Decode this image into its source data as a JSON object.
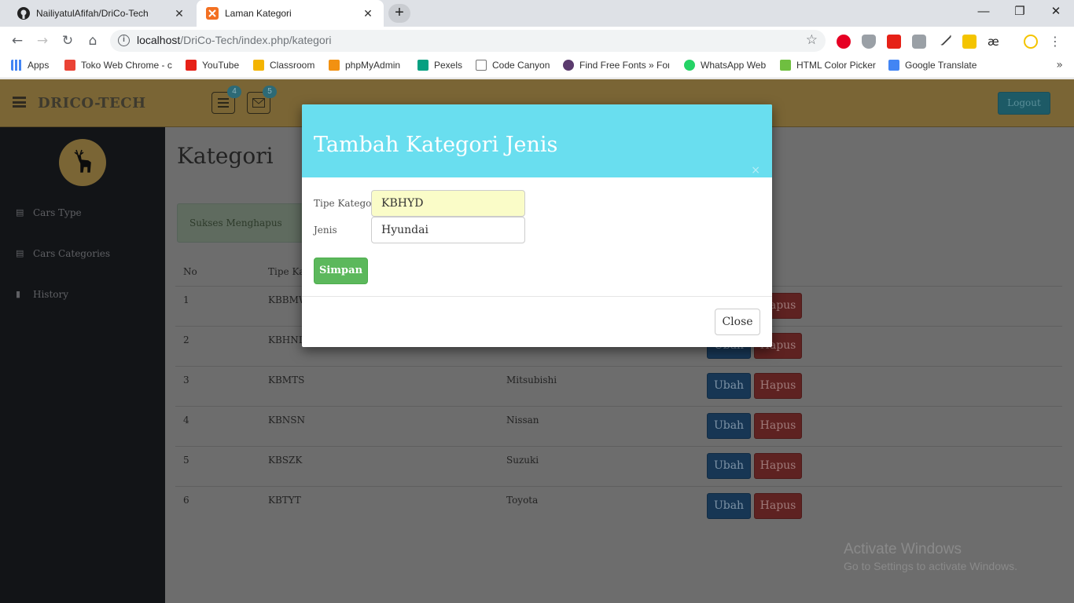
{
  "browser": {
    "tabs": [
      {
        "title": "NailiyatulAfifah/DriCo-Tech",
        "active": false
      },
      {
        "title": "Laman Kategori",
        "active": true
      }
    ],
    "url_host": "localhost",
    "url_path": "/DriCo-Tech/index.php/kategori",
    "bookmarks": [
      "Apps",
      "Toko Web Chrome - c",
      "YouTube",
      "Classroom",
      "phpMyAdmin",
      "Pexels",
      "Code Canyon",
      "Find Free Fonts » Fon",
      "WhatsApp Web",
      "HTML Color Picker",
      "Google Translate"
    ],
    "bookmarks_more": "»"
  },
  "app": {
    "brand": "DRICO-TECH",
    "badge_tasks": "4",
    "badge_messages": "5",
    "logout_label": "Logout",
    "sidebar": [
      {
        "label": "Cars Type",
        "icon": "book-icon"
      },
      {
        "label": "Cars Categories",
        "icon": "book-icon"
      },
      {
        "label": "History",
        "icon": "bookmark-icon"
      }
    ],
    "page_title": "Kategori",
    "alert_text": "Sukses Menghapus",
    "table": {
      "headers": [
        "No",
        "Tipe Ka"
      ],
      "rows": [
        {
          "no": "1",
          "tipe": "KBBMW",
          "jenis": "",
          "ubah": "",
          "hapus": "Hapus"
        },
        {
          "no": "2",
          "tipe": "KBHND",
          "jenis": "",
          "ubah": "Ubah",
          "hapus": "Hapus"
        },
        {
          "no": "3",
          "tipe": "KBMTS",
          "jenis": "Mitsubishi",
          "ubah": "Ubah",
          "hapus": "Hapus"
        },
        {
          "no": "4",
          "tipe": "KBNSN",
          "jenis": "Nissan",
          "ubah": "Ubah",
          "hapus": "Hapus"
        },
        {
          "no": "5",
          "tipe": "KBSZK",
          "jenis": "Suzuki",
          "ubah": "Ubah",
          "hapus": "Hapus"
        },
        {
          "no": "6",
          "tipe": "KBTYT",
          "jenis": "Toyota",
          "ubah": "Ubah",
          "hapus": "Hapus"
        }
      ]
    }
  },
  "modal": {
    "title": "Tambah Kategori Jenis",
    "close_x": "×",
    "fields": [
      {
        "label": "Tipe Kategori",
        "value": "KBHYD"
      },
      {
        "label": "Jenis",
        "value": "Hyundai"
      }
    ],
    "submit_label": "Simpan",
    "close_label": "Close"
  },
  "watermark": {
    "line1": "Activate Windows",
    "line2": "Go to Settings to activate Windows."
  },
  "colors": {
    "modal_header": "#69deef",
    "submit": "#5cb85c",
    "overlay_header": "#7a6535",
    "sidebar": "#121417"
  }
}
